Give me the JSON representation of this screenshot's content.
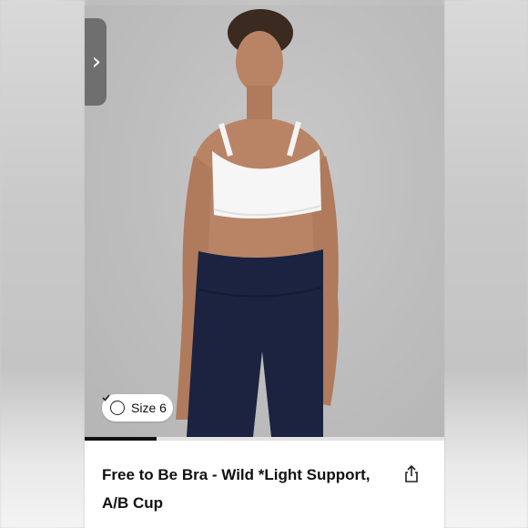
{
  "product": {
    "title": "Free to Be Bra - Wild *Light Support, A/B Cup"
  },
  "size_chip": {
    "label": "Size 6",
    "icon": "check-circle-icon"
  },
  "gallery": {
    "progress": 0.2,
    "prev_icon": "chevron-right-icon"
  },
  "actions": {
    "share_icon": "share-icon"
  },
  "colors": {
    "progress_fill": "#111111",
    "progress_track": "#e3e3e3",
    "nav_tab": "#6f6f6f",
    "background_gray": "#c4c4c4"
  }
}
